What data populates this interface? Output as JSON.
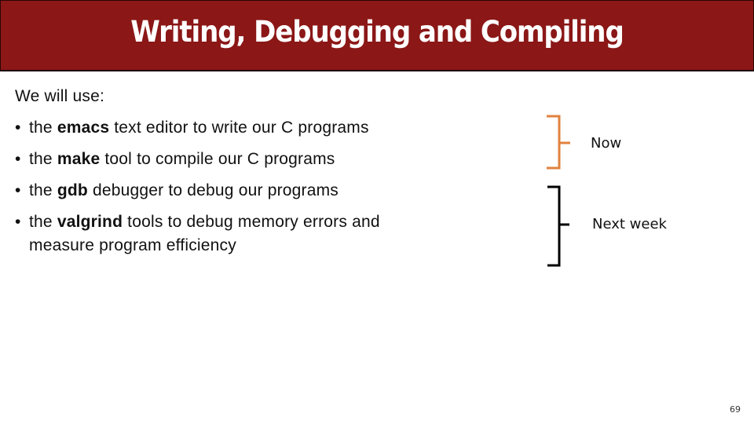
{
  "slide": {
    "title": "Writing, Debugging and Compiling",
    "intro": "We will use:",
    "bullets": [
      {
        "pre": "the ",
        "bold": "emacs",
        "post": " text editor to write our C programs"
      },
      {
        "pre": "the ",
        "bold": "make",
        "post": " tool to compile our C programs"
      },
      {
        "pre": "the ",
        "bold": "gdb",
        "post": " debugger to debug our programs"
      },
      {
        "pre": "the ",
        "bold": "valgrind",
        "post": " tools to debug memory errors and",
        "continuation": "measure program efficiency"
      }
    ],
    "bullet_glyph": "•",
    "groups": [
      {
        "label": "Now",
        "color": "#e0823e"
      },
      {
        "label": "Next week",
        "color": "#000000"
      }
    ],
    "page_number": "69",
    "colors": {
      "title_bg": "#8b1717",
      "title_text": "#ffffff"
    }
  }
}
